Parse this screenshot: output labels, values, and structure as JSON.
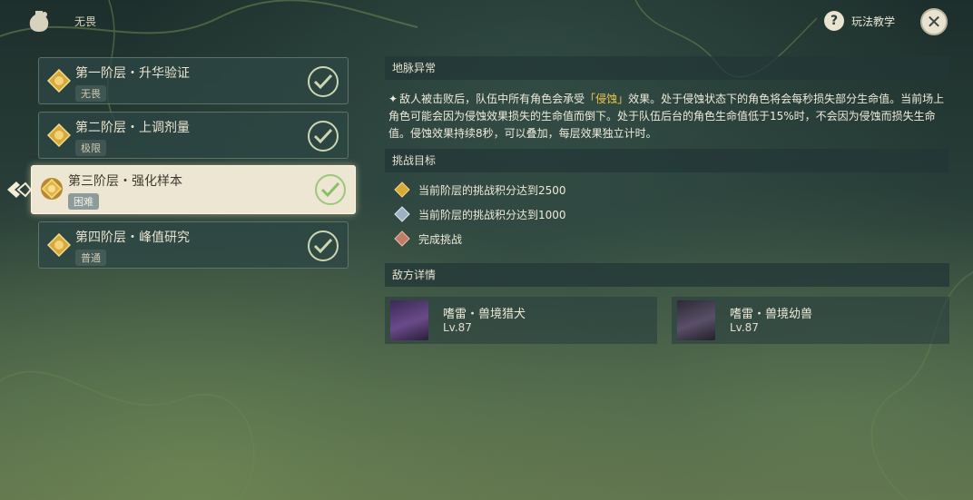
{
  "header": {
    "mode_label": "无畏",
    "help_label": "玩法教学",
    "close_symbol": "✕"
  },
  "stages": [
    {
      "title": "第一阶层・升华验证",
      "difficulty": "无畏",
      "completed": true
    },
    {
      "title": "第二阶层・上调剂量",
      "difficulty": "极限",
      "completed": true
    },
    {
      "title": "第三阶层・强化样本",
      "difficulty": "困难",
      "completed": true,
      "selected": true
    },
    {
      "title": "第四阶层・峰值研究",
      "difficulty": "普通",
      "completed": true
    }
  ],
  "ley_line": {
    "heading": "地脉异常",
    "text_before": "敌人被击败后，队伍中所有角色会承受",
    "highlight": "「侵蚀」",
    "text_after": "效果。处于侵蚀状态下的角色将会每秒损失部分生命值。当前场上角色可能会因为侵蚀效果损失的生命值而倒下。处于队伍后台的角色生命值低于15%时，不会因为侵蚀而损失生命值。侵蚀效果持续8秒，可以叠加，每层效果独立计时。"
  },
  "challenge": {
    "heading": "挑战目标",
    "goals": [
      {
        "text": "当前阶层的挑战积分达到2500",
        "icon": "gold-medal-icon"
      },
      {
        "text": "当前阶层的挑战积分达到1000",
        "icon": "silver-medal-icon"
      },
      {
        "text": "完成挑战",
        "icon": "bronze-medal-icon"
      }
    ]
  },
  "enemies": {
    "heading": "敌方详情",
    "list": [
      {
        "name": "嗜雷・兽境猎犬",
        "level": "Lv.87"
      },
      {
        "name": "嗜雷・兽境幼兽",
        "level": "Lv.87"
      }
    ]
  },
  "colors": {
    "highlight": "#f1c64a",
    "check": "#cbd7b0"
  }
}
